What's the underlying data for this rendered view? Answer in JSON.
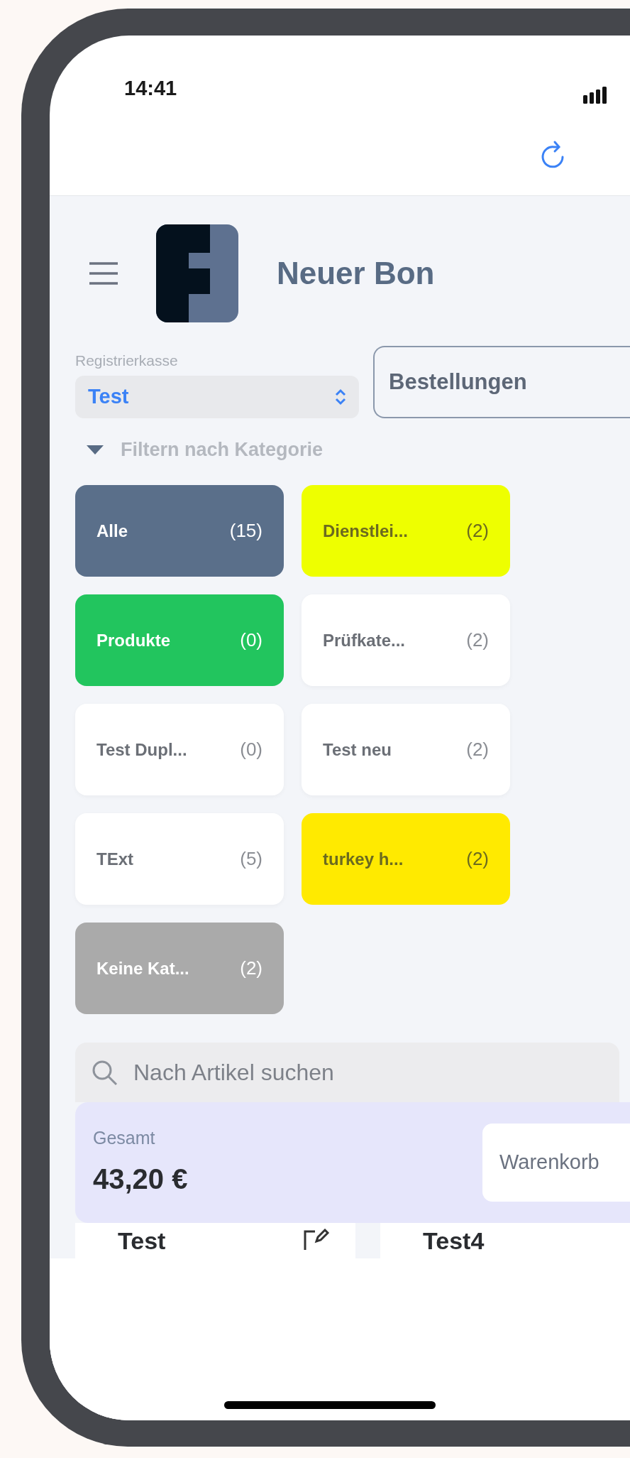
{
  "status_bar": {
    "time": "14:41"
  },
  "header": {
    "title": "Neuer Bon"
  },
  "register": {
    "label": "Registrierkasse",
    "value": "Test"
  },
  "mode_field": {
    "value": "Bestellungen"
  },
  "filter": {
    "label": "Filtern nach Kategorie",
    "expanded": true
  },
  "categories": [
    {
      "name": "Alle",
      "count": "(15)",
      "color": "#5a6f8a"
    },
    {
      "name": "Dienstlei...",
      "count": "(2)",
      "color": "#eeff00"
    },
    {
      "name": "Produkte",
      "count": "(0)",
      "color": "#22c55e"
    },
    {
      "name": "Prüfkate...",
      "count": "(2)",
      "color": "#ffffff"
    },
    {
      "name": "Test Dupl...",
      "count": "(0)",
      "color": "#ffffff"
    },
    {
      "name": "Test neu",
      "count": "(2)",
      "color": "#ffffff"
    },
    {
      "name": "TExt",
      "count": "(5)",
      "color": "#ffffff"
    },
    {
      "name": "turkey h...",
      "count": "(2)",
      "color": "#ffea00"
    },
    {
      "name": "Keine Kat...",
      "count": "(2)",
      "color": "#aaaaaa"
    }
  ],
  "search": {
    "placeholder": "Nach Artikel suchen"
  },
  "total": {
    "label": "Gesamt",
    "amount": "43,20 €",
    "cart_button": "Warenkorb"
  },
  "items": [
    {
      "name": "Test",
      "editable": true
    },
    {
      "name": "Test4",
      "editable": false
    }
  ]
}
